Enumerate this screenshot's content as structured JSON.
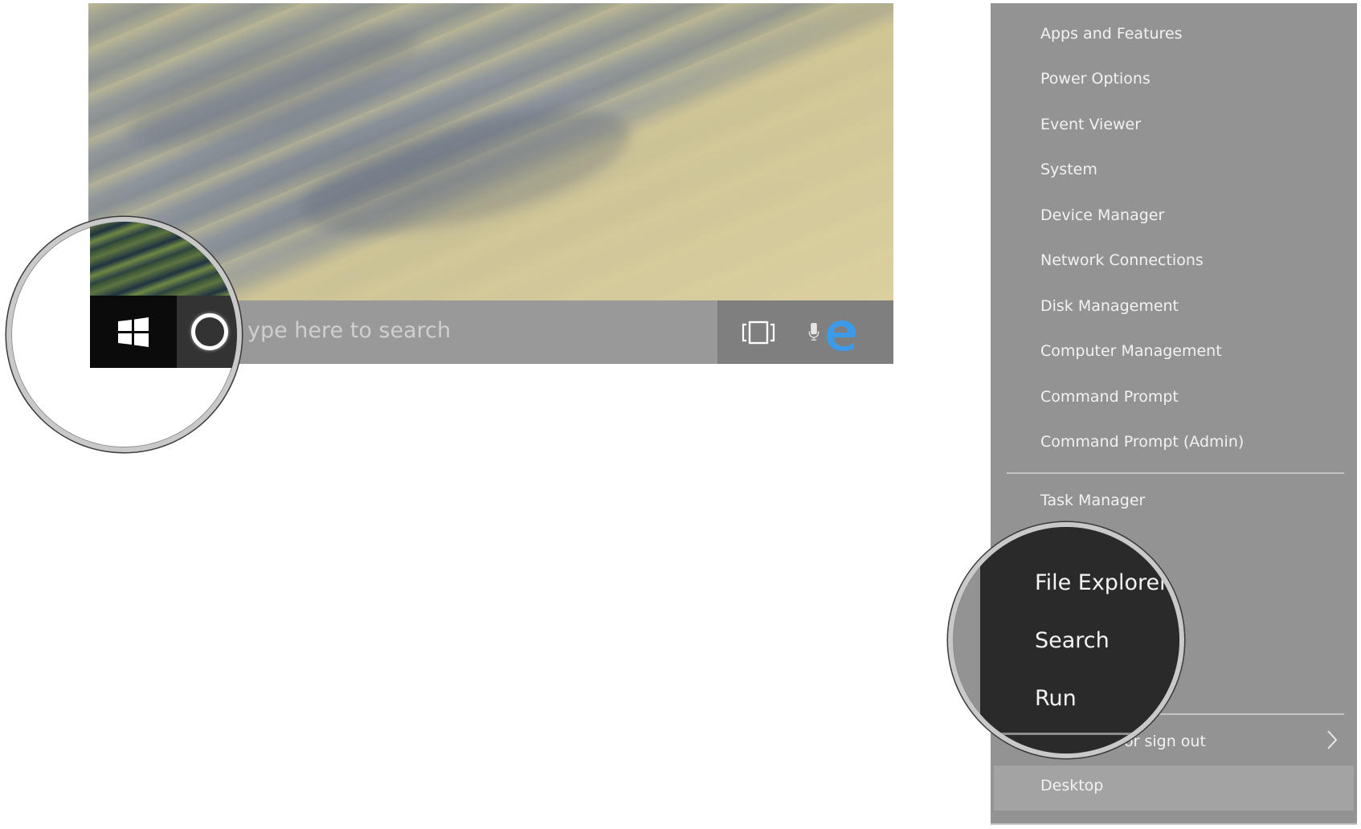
{
  "taskbar": {
    "search_placeholder": "ype here to search",
    "icons": {
      "start": "windows-logo-icon",
      "cortana": "cortana-ring-icon",
      "microphone": "microphone-icon",
      "task_view": "task-view-icon",
      "edge": "edge-browser-icon"
    },
    "edge_color": "#3d9ae8"
  },
  "left_magnifier": {
    "shows": [
      "start-button",
      "cortana-button"
    ]
  },
  "winx_menu": {
    "items": [
      {
        "label": "Apps and Features"
      },
      {
        "label": "Power Options"
      },
      {
        "label": "Event Viewer"
      },
      {
        "label": "System"
      },
      {
        "label": "Device Manager"
      },
      {
        "label": "Network Connections"
      },
      {
        "label": "Disk Management"
      },
      {
        "label": "Computer Management"
      },
      {
        "label": "Command Prompt"
      },
      {
        "label": "Command Prompt (Admin)"
      }
    ],
    "group2": [
      {
        "label": "Task Manager"
      }
    ],
    "shutdown_label": "or sign out",
    "desktop_label": "Desktop",
    "colors": {
      "background": "#939393",
      "highlight": "#a3a3a3",
      "text": "#f2f2f2"
    }
  },
  "right_magnifier": {
    "items": [
      {
        "label": "File Explorer"
      },
      {
        "label": "Search"
      },
      {
        "label": "Run"
      }
    ],
    "background": "#2a2a2a"
  }
}
